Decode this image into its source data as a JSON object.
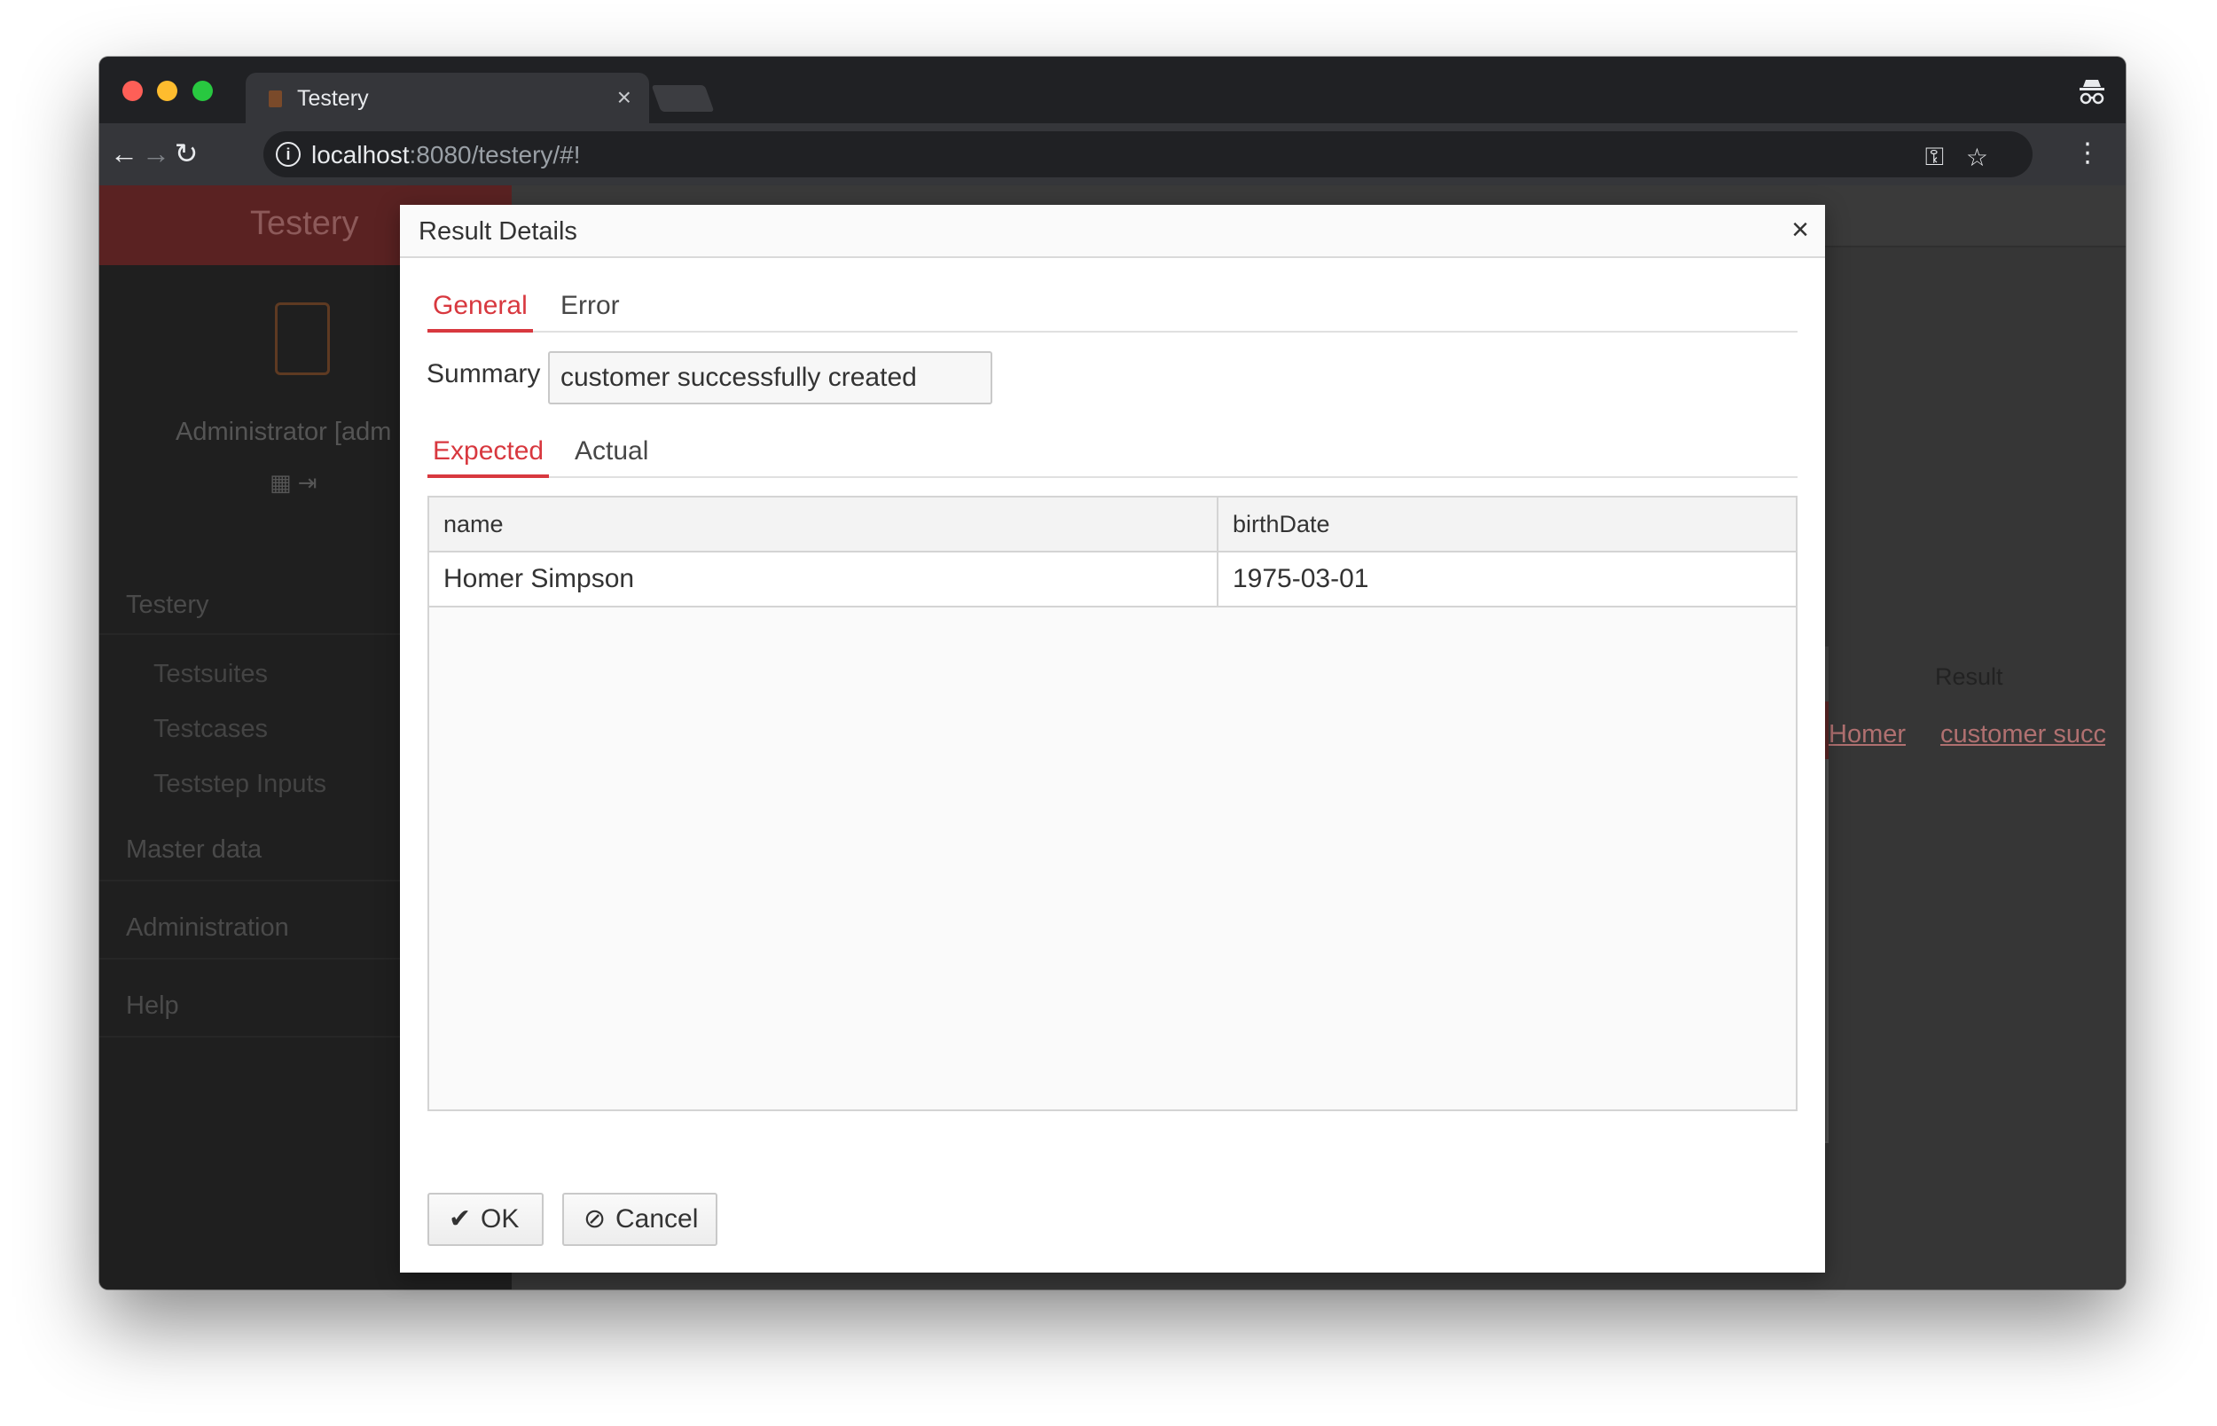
{
  "browser": {
    "tab_title": "Testery",
    "tab_close": "×",
    "url_host": "localhost",
    "url_rest": ":8080/testery/#!",
    "icons": [
      "back-icon",
      "forward-icon",
      "reload-icon",
      "info-icon",
      "key-icon",
      "star-icon",
      "menu-icon",
      "incognito-icon"
    ]
  },
  "sidebar": {
    "brand": "Testery",
    "user": "Administrator [adm",
    "section_testery": "Testery",
    "items": [
      "Testsuites",
      "Testcases",
      "Teststep Inputs"
    ],
    "section_master": "Master data",
    "section_admin": "Administration",
    "section_help": "Help"
  },
  "underlay": {
    "result_header": "Result",
    "row_name": "Homer",
    "row_result": "customer succ"
  },
  "dialog": {
    "title": "Result Details",
    "close": "×",
    "tabs": [
      {
        "label": "General",
        "active": true
      },
      {
        "label": "Error",
        "active": false
      }
    ],
    "summary_label": "Summary",
    "summary_value": "customer successfully created",
    "subtabs": [
      {
        "label": "Expected",
        "active": true
      },
      {
        "label": "Actual",
        "active": false
      }
    ],
    "grid": {
      "columns": [
        "name",
        "birthDate"
      ],
      "rows": [
        [
          "Homer Simpson",
          "1975-03-01"
        ]
      ]
    },
    "ok_label": "OK",
    "cancel_label": "Cancel"
  },
  "colors": {
    "accent": "#d8383f",
    "brand_dim": "#5a2222"
  }
}
